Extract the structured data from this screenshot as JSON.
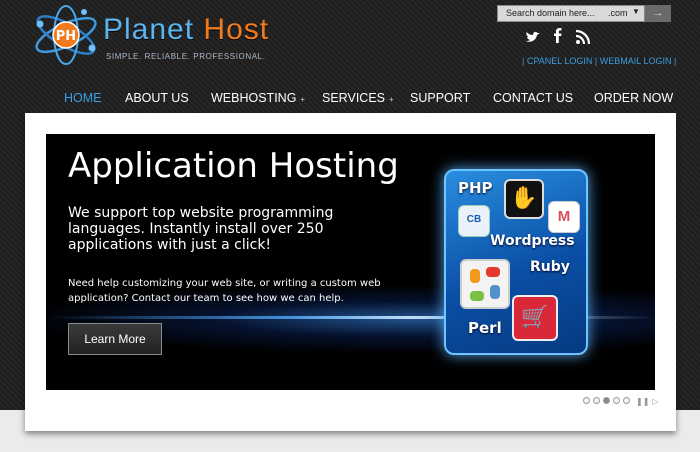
{
  "brand": {
    "name_part1": "Planet",
    "name_part2": "Host",
    "emblem_letter": "PH",
    "tagline": "SIMPLE. RELIABLE. PROFESSIONAL."
  },
  "search": {
    "placeholder": "Search domain here...",
    "tld": ".com",
    "caret": "▼",
    "button": "→"
  },
  "social": {
    "twitter": "twitter-icon",
    "facebook": "facebook-icon",
    "rss": "rss-icon"
  },
  "login_links": {
    "sep": "|",
    "cpanel": "CPANEL LOGIN",
    "webmail": "WEBMAIL LOGIN"
  },
  "nav": {
    "items": [
      {
        "label": "HOME"
      },
      {
        "label": "ABOUT US"
      },
      {
        "label": "WEBHOSTING",
        "plus": "+"
      },
      {
        "label": "SERVICES",
        "plus": "+"
      },
      {
        "label": "SUPPORT"
      },
      {
        "label": "CONTACT US"
      },
      {
        "label": "ORDER NOW"
      }
    ],
    "active_index": 0
  },
  "slide": {
    "title": "Application Hosting",
    "lead": "We support top website programming languages. Instantly install over 250 applications with just a click!",
    "sub": "Need help customizing your web site, or writing a custom web application?  Contact our team to see how we can help.",
    "button": "Learn More",
    "apps": {
      "php": "PHP",
      "wordpress": "Wordpress",
      "ruby": "Ruby",
      "perl": "Perl",
      "clipbucket": "CB"
    }
  },
  "pager": {
    "count": 5,
    "active": 2
  },
  "colors": {
    "accent": "#3a9ee4",
    "brand_blue": "#5bb4ee",
    "brand_orange": "#f07b1e"
  }
}
